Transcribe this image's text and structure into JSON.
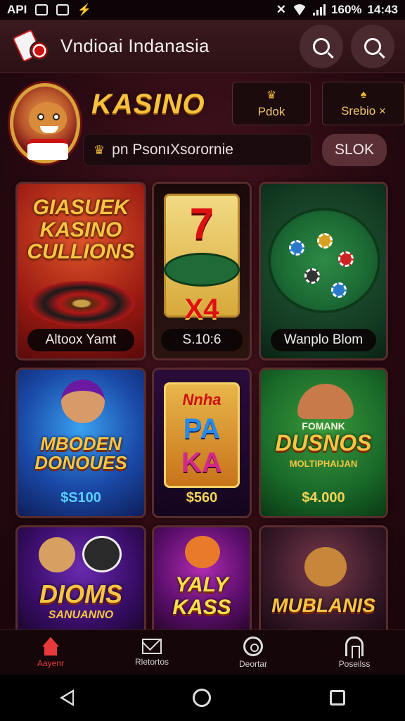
{
  "status_bar": {
    "carrier": "API",
    "battery": "160%",
    "time": "14:43"
  },
  "header": {
    "title": "Vndioai Indanasia",
    "search_icon": "search-icon",
    "search_icon_2": "search-icon"
  },
  "banner": {
    "title": "KASINO",
    "button_1": "Pdok",
    "button_2": "Srebio",
    "button_2_suffix": "×",
    "promo_text": "pn PsonıXsorornie",
    "stok_label": "SLOK"
  },
  "games": [
    {
      "title": "GIASUEK KASINO CULLIONS",
      "label": "Altoox Yamt"
    },
    {
      "title_top": "7",
      "title_bottom": "X4",
      "label": "S.10:6"
    },
    {
      "label": "Wanplo Blom"
    },
    {
      "title": "MBODEN DONOUES",
      "price": "$S100"
    },
    {
      "title_top": "PA",
      "title_bottom": "KA",
      "sign": "Nnha",
      "price": "$560"
    },
    {
      "title": "DUSNOS",
      "subtitle_top": "FOMANK",
      "subtitle_bottom": "MOLTIPHAIJAN",
      "price": "$4.000"
    },
    {
      "title": "DIOMS",
      "subtitle": "SANUANNO"
    },
    {
      "title": "YALY KASS"
    },
    {
      "title": "MUBLANIS"
    }
  ],
  "bottom_nav": [
    {
      "label": "Aayenr",
      "icon": "home-icon"
    },
    {
      "label": "Rletortos",
      "icon": "envelope-icon"
    },
    {
      "label": "Deortar",
      "icon": "target-icon"
    },
    {
      "label": "Poseilss",
      "icon": "arch-icon"
    }
  ],
  "colors": {
    "accent": "#e83a3a",
    "gold": "#f6c23d",
    "background": "#2a0a12"
  }
}
